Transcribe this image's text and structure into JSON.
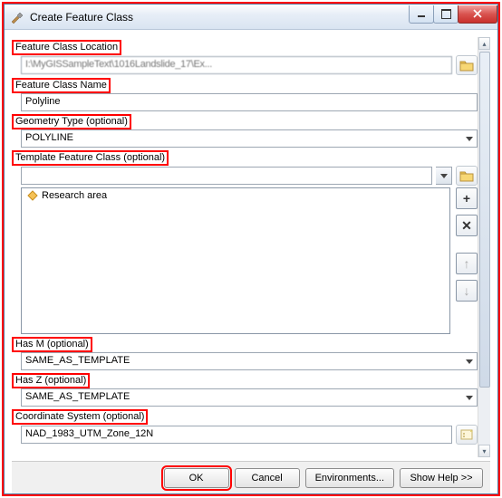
{
  "window": {
    "title": "Create Feature Class"
  },
  "labels": {
    "location": "Feature Class Location",
    "name": "Feature Class Name",
    "geometry": "Geometry Type (optional)",
    "template": "Template Feature Class (optional)",
    "hasm": "Has M (optional)",
    "hasz": "Has Z (optional)",
    "coord": "Coordinate System (optional)"
  },
  "values": {
    "location_path": "  I:\\MyGISSampleText\\1016Landslide_17\\Ex...",
    "name": "Polyline",
    "geometry": "POLYLINE",
    "template_item": "Research area",
    "hasm": "SAME_AS_TEMPLATE",
    "hasz": "SAME_AS_TEMPLATE",
    "coord": "NAD_1983_UTM_Zone_12N"
  },
  "buttons": {
    "ok": "OK",
    "cancel": "Cancel",
    "environments": "Environments...",
    "showhelp": "Show Help >>"
  },
  "side": {
    "add": "+",
    "remove": "✕",
    "up": "↑",
    "down": "↓"
  },
  "scroll": {
    "up": "▴",
    "down": "▾"
  }
}
